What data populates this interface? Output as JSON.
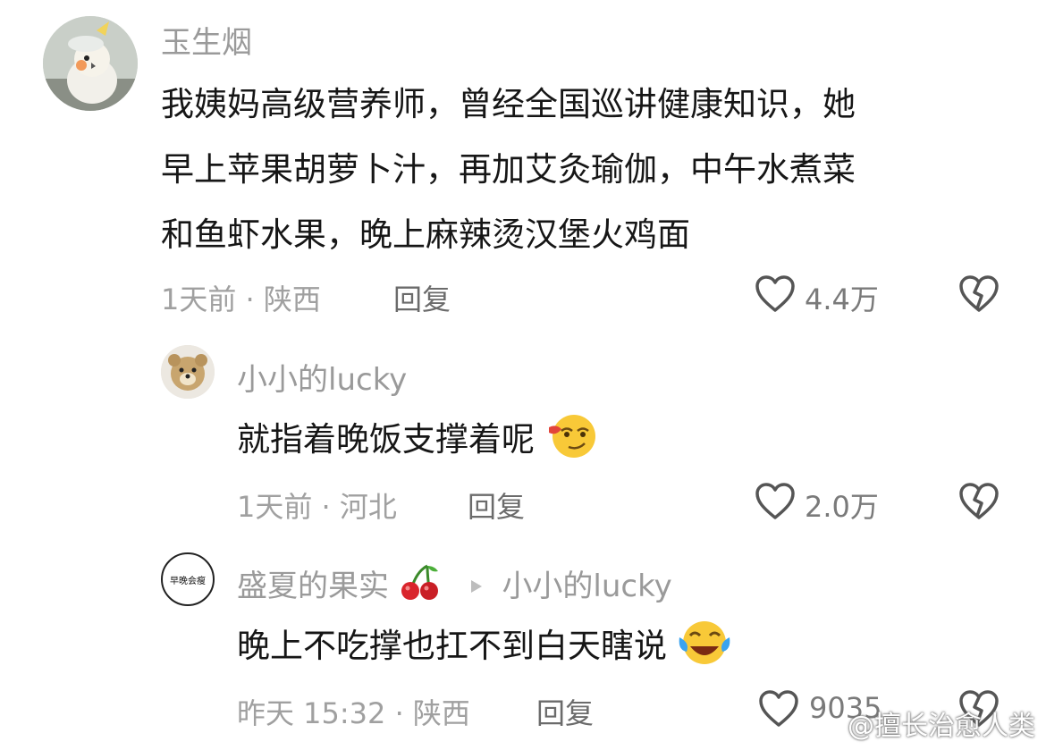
{
  "comments": [
    {
      "username": "玉生烟",
      "lines": [
        "我姨妈高级营养师，曾经全国巡讲健康知识，她",
        "早上苹果胡萝卜汁，再加艾灸瑜伽，中午水煮菜",
        "和鱼虾水果，晚上麻辣烫汉堡火鸡面"
      ],
      "meta": "1天前 · 陕西",
      "reply_label": "回复",
      "likes": "4.4万"
    },
    {
      "username": "小小的lucky",
      "text": "就指着晚饭支撑着呢",
      "meta": "1天前 · 河北",
      "reply_label": "回复",
      "likes": "2.0万"
    },
    {
      "username": "盛夏的果实",
      "reply_to": "小小的lucky",
      "text": "晚上不吃撑也扛不到白天瞎说",
      "meta": "昨天 15:32 · 陕西",
      "reply_label": "回复",
      "likes": "9035",
      "avatar_text": "早晚会瘦"
    }
  ],
  "watermark": "@擅长治愈人类",
  "icons": [
    "heart-icon",
    "dislike-broken-heart-icon",
    "play-triangle-icon",
    "cherry-emoji",
    "smirk-emoji",
    "laughing-crying-emoji",
    "weibo-logo"
  ]
}
